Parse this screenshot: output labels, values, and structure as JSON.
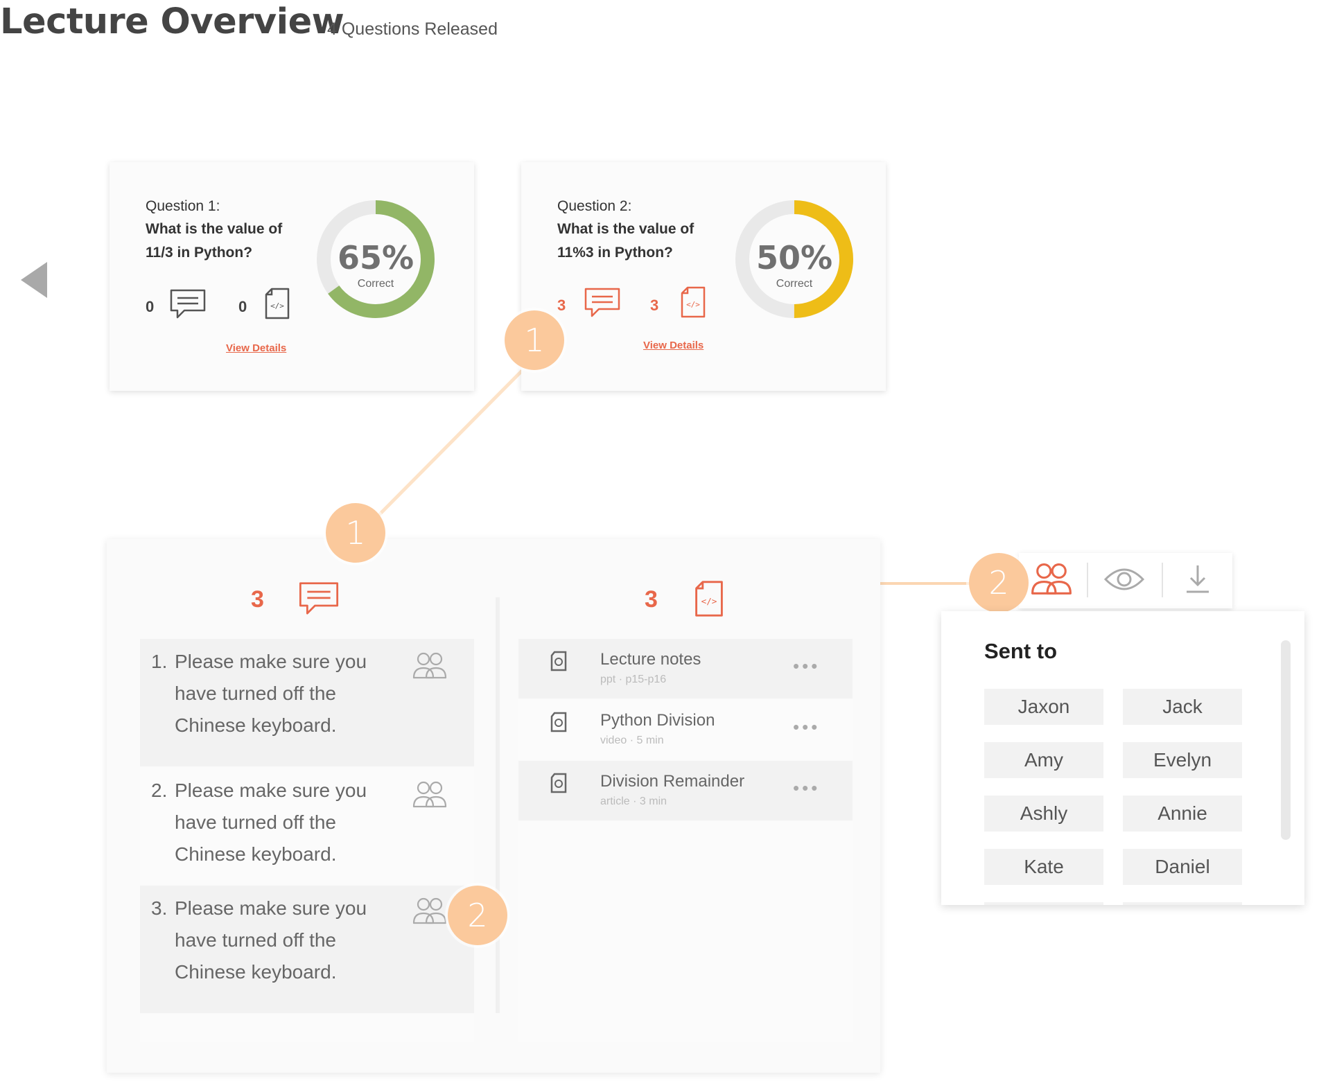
{
  "header": {
    "title": "Lecture Overview",
    "subtitle": "4 Questions Released"
  },
  "questions": [
    {
      "label": "Question 1:",
      "text_line1": "What is the value of",
      "text_line2": "11/3 in Python?",
      "comment_count": "0",
      "code_count": "0",
      "percent_correct": 65,
      "percent_label": "65%",
      "correct_label": "Correct",
      "ring_color": "#92b666",
      "link": "View Details"
    },
    {
      "label": "Question 2:",
      "text_line1": "What is the value of",
      "text_line2": "11%3 in Python?",
      "comment_count": "3",
      "code_count": "3",
      "percent_correct": 50,
      "percent_label": "50%",
      "correct_label": "Correct",
      "ring_color": "#eebd17",
      "link": "View Details"
    }
  ],
  "callouts": {
    "one": "1",
    "two": "2"
  },
  "detail": {
    "comment_count": "3",
    "code_count": "3",
    "feedback": [
      {
        "num": "1.",
        "lines": [
          "Please make sure you",
          "have turned off the",
          "Chinese keyboard."
        ]
      },
      {
        "num": "2.",
        "lines": [
          "Please make sure you",
          "have turned off the",
          "Chinese keyboard."
        ]
      },
      {
        "num": "3.",
        "lines": [
          "Please make sure you",
          "have turned off the",
          "Chinese keyboard."
        ]
      }
    ],
    "resources": [
      {
        "title": "Lecture notes",
        "meta": "ppt · p15-p16",
        "more": "•••"
      },
      {
        "title": "Python Division",
        "meta": "video · 5 min",
        "more": "•••"
      },
      {
        "title": "Division Remainder",
        "meta": "article · 3 min",
        "more": "•••"
      }
    ]
  },
  "toolbar": {
    "icons": [
      "people-icon",
      "eye-icon",
      "download-icon"
    ]
  },
  "sent_to": {
    "title": "Sent to",
    "names": [
      "Jaxon",
      "Jack",
      "Amy",
      "Evelyn",
      "Ashly",
      "Annie",
      "Kate",
      "Daniel"
    ]
  },
  "colors": {
    "accent": "#e8674a",
    "callout": "#fbc99c",
    "green": "#92b666",
    "yellow": "#eebd17"
  }
}
